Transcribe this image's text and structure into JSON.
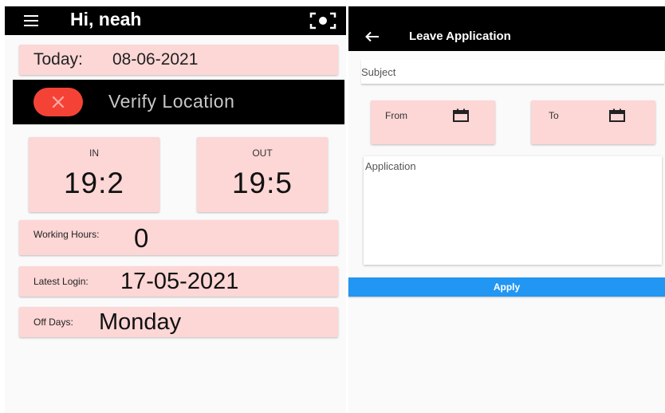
{
  "home": {
    "greeting": "Hi, neah",
    "menu_icon": "hamburger-menu-icon",
    "scan_icon": "scan-location-icon",
    "today_label": "Today:",
    "today_value": "08-06-2021",
    "verify_label": "Verify Location",
    "verify_icon": "close-icon",
    "verify_color": "#f44336",
    "in_label": "IN",
    "in_value": "19:2",
    "out_label": "OUT",
    "out_value": "19:5",
    "working_hours_label": "Working Hours:",
    "working_hours_value": "0",
    "latest_login_label": "Latest Login:",
    "latest_login_value": "17-05-2021",
    "off_days_label": "Off Days:",
    "off_days_value": "Monday",
    "card_color": "#fdd6d6"
  },
  "leave": {
    "title": "Leave Application",
    "back_icon": "arrow-back-icon",
    "subject_placeholder": "Subject",
    "from_label": "From",
    "to_label": "To",
    "calendar_icon": "calendar-icon",
    "application_placeholder": "Application",
    "apply_label": "Apply",
    "apply_color": "#2196f3"
  }
}
